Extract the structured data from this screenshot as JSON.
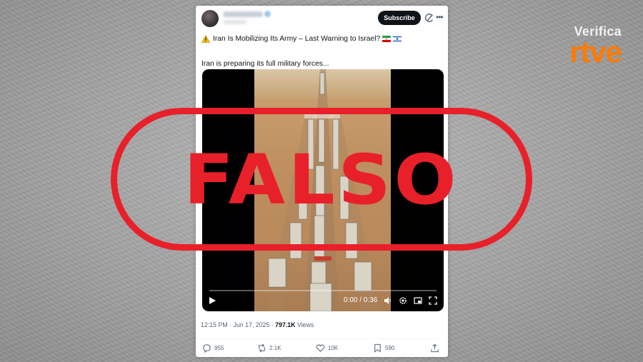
{
  "brand": {
    "top": "Verifica",
    "bottom": "rtve",
    "accent_color": "#ff7a00"
  },
  "tweet": {
    "subscribe_label": "Subscribe",
    "headline": "Iran Is Mobilizing Its Army – Last Warning to Israel?",
    "headline_icons": [
      "warning-icon",
      "iran-flag-icon",
      "israel-flag-icon"
    ],
    "body": "Iran is preparing its full military forces...",
    "video": {
      "time": "0:00 / 0:36",
      "controls": [
        "play-icon",
        "volume-icon",
        "settings-icon",
        "pip-icon",
        "fullscreen-icon"
      ]
    },
    "meta": {
      "datetime": "12:15 PM · Jun 17, 2025 · ",
      "views_count": "797.1K",
      "views_label": " Views"
    },
    "actions": {
      "replies": "955",
      "reposts": "2.1K",
      "likes": "10K",
      "bookmarks": "590"
    }
  },
  "stamp": {
    "text": "FALSO",
    "color": "#e8202a"
  }
}
